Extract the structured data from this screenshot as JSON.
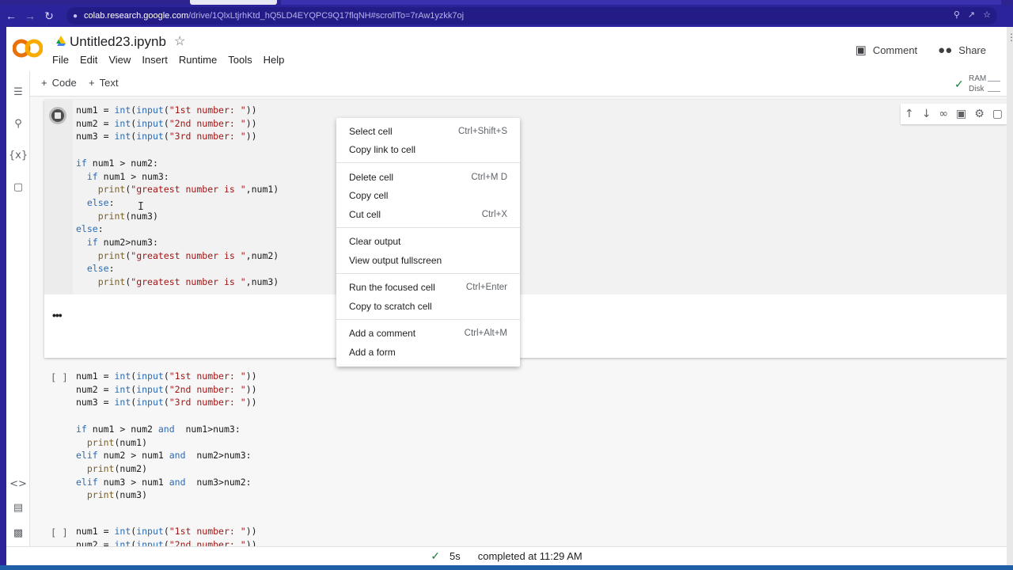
{
  "browser": {
    "url_host": "colab.research.google.com",
    "url_path": "/drive/1QlxLtjrhKtd_hQ5LD4EYQPC9Q17flqNH#scrollTo=7rAw1yzkk7oj"
  },
  "header": {
    "logo_text": "CO",
    "title": "Untitled23.ipynb",
    "menu": [
      "File",
      "Edit",
      "View",
      "Insert",
      "Runtime",
      "Tools",
      "Help"
    ],
    "comment_label": "Comment",
    "share_label": "Share"
  },
  "toolbar": {
    "add_code": "Code",
    "add_text": "Text",
    "ram_label": "RAM",
    "disk_label": "Disk"
  },
  "cells": [
    {
      "state": "running",
      "lines": [
        "num1 = int(input(\"1st number: \"))",
        "num2 = int(input(\"2nd number: \"))",
        "num3 = int(input(\"3rd number: \"))",
        "",
        "if num1 > num2:",
        "  if num1 > num3:",
        "    print(\"greatest number is \",num1)",
        "  else:",
        "    print(num3)",
        "else:",
        "  if num2>num3:",
        "    print(\"greatest number is \",num2)",
        "  else:",
        "    print(\"greatest number is \",num3)"
      ],
      "output": "•••"
    },
    {
      "state": "idle",
      "bracket": "[ ]",
      "lines": [
        "num1 = int(input(\"1st number: \"))",
        "num2 = int(input(\"2nd number: \"))",
        "num3 = int(input(\"3rd number: \"))",
        "",
        "if num1 > num2 and  num1>num3:",
        "  print(num1)",
        "elif num2 > num1 and  num2>num3:",
        "  print(num2)",
        "elif num3 > num1 and  num3>num2:",
        "  print(num3)"
      ]
    },
    {
      "state": "idle",
      "bracket": "[ ]",
      "lines": [
        "num1 = int(input(\"1st number: \"))",
        "num2 = int(input(\"2nd number: \"))"
      ]
    }
  ],
  "context_menu": {
    "items": [
      {
        "label": "Select cell",
        "shortcut": "Ctrl+Shift+S"
      },
      {
        "label": "Copy link to cell",
        "shortcut": ""
      },
      {
        "label": "Delete cell",
        "shortcut": "Ctrl+M D"
      },
      {
        "label": "Copy cell",
        "shortcut": ""
      },
      {
        "label": "Cut cell",
        "shortcut": "Ctrl+X"
      },
      {
        "label": "Clear output",
        "shortcut": ""
      },
      {
        "label": "View output fullscreen",
        "shortcut": ""
      },
      {
        "label": "Run the focused cell",
        "shortcut": "Ctrl+Enter"
      },
      {
        "label": "Copy to scratch cell",
        "shortcut": ""
      },
      {
        "label": "Add a comment",
        "shortcut": "Ctrl+Alt+M"
      },
      {
        "label": "Add a form",
        "shortcut": ""
      }
    ]
  },
  "status": {
    "duration": "5s",
    "message": "completed at 11:29 AM"
  },
  "colors": {
    "browser_chrome": "#2b2399",
    "logo_orange": "#f9ab00",
    "logo_dark": "#e8710a",
    "check_green": "#188038"
  }
}
